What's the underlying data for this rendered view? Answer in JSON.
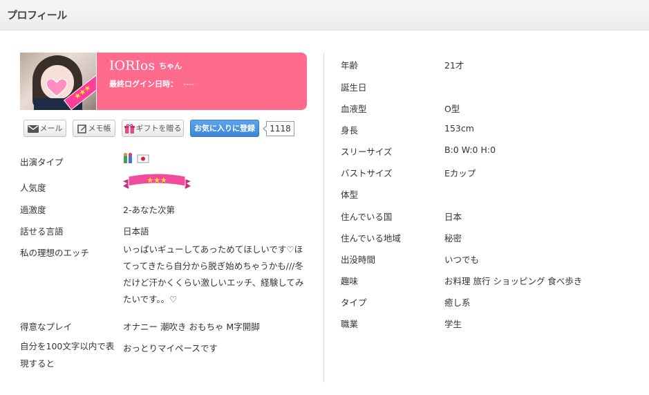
{
  "header": {
    "title": "プロフィール"
  },
  "profile": {
    "name": "IORIos",
    "honorific": "ちゃん",
    "last_login_label": "最終ログイン日時：",
    "last_login_value": "----",
    "photo_stars": "★★★"
  },
  "actions": {
    "mail": "メール",
    "memo": "メモ帳",
    "gift": "ギフトを贈る",
    "favorite": "お気に入りに登録",
    "favorite_count": "1118"
  },
  "left_fields": [
    {
      "label": "出演タイプ",
      "value": ""
    },
    {
      "label": "人気度",
      "value": ""
    },
    {
      "label": "過激度",
      "value": "2-あなた次第"
    },
    {
      "label": "話せる言語",
      "value": "日本語"
    },
    {
      "label": "私の理想のエッチ",
      "value": "いっぱいギューしてあっためてほしいです♡ほてってきたら自分から脱ぎ始めちゃうかも///冬だけど汗かくくらい激しいエッチ、経験してみたいです。。♡"
    },
    {
      "label": "得意なプレイ",
      "value": "オナニー 潮吹き おもちゃ M字開脚"
    },
    {
      "label": "自分を100文字以内で表現すると",
      "value": "おっとりマイペースです"
    }
  ],
  "popularity_stars": "★★★",
  "right_fields": [
    {
      "label": "年齢",
      "value": "21才"
    },
    {
      "label": "誕生日",
      "value": ""
    },
    {
      "label": "血液型",
      "value": "O型"
    },
    {
      "label": "身長",
      "value": "153cm"
    },
    {
      "label": "スリーサイズ",
      "value": "B:0 W:0 H:0"
    },
    {
      "label": "バストサイズ",
      "value": "Eカップ"
    },
    {
      "label": "体型",
      "value": ""
    },
    {
      "label": "住んでいる国",
      "value": "日本"
    },
    {
      "label": "住んでいる地域",
      "value": "秘密"
    },
    {
      "label": "出没時間",
      "value": "いつでも"
    },
    {
      "label": "趣味",
      "value": "お料理 旅行 ショッピング 食べ歩き"
    },
    {
      "label": "タイプ",
      "value": "癒し系"
    },
    {
      "label": "職業",
      "value": "学生"
    }
  ],
  "colors": {
    "card": "#ff6a8d",
    "favorite_button": "#3b86d6"
  }
}
